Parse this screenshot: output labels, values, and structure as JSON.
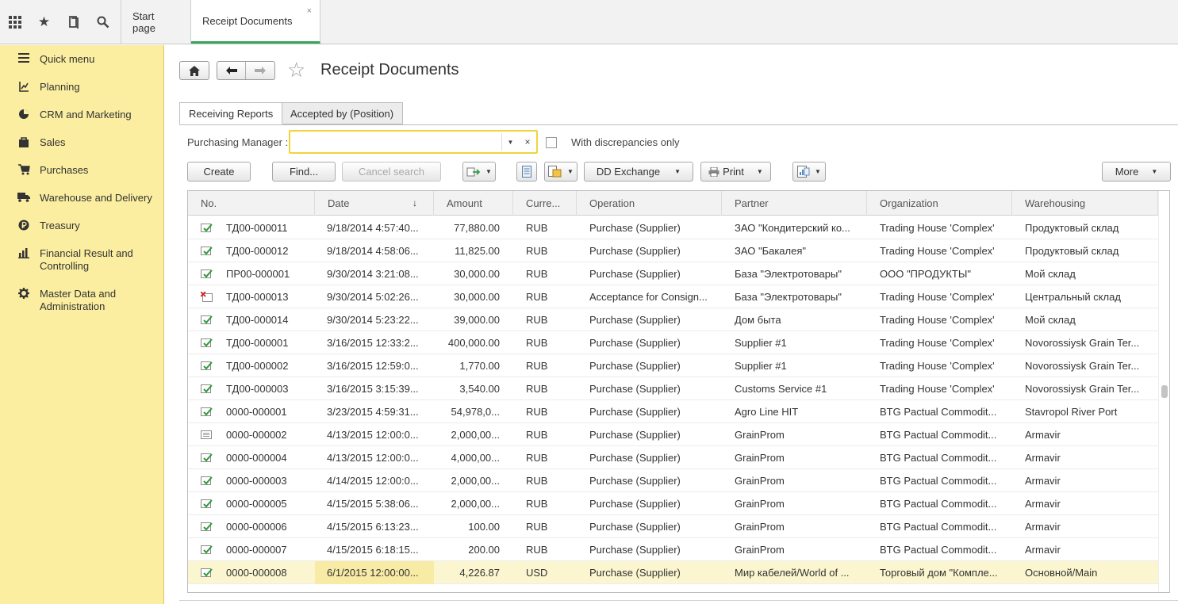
{
  "topbar": {
    "icons": [
      "apps-grid-icon",
      "star-icon",
      "history-icon",
      "search-icon"
    ],
    "tabs": [
      {
        "label": "Start page"
      },
      {
        "label": "Receipt Documents",
        "close": "×"
      }
    ]
  },
  "sidebar": {
    "items": [
      {
        "label": "Quick menu",
        "icon": "menu-lines-icon"
      },
      {
        "label": "Planning",
        "icon": "planning-icon"
      },
      {
        "label": "CRM and Marketing",
        "icon": "pie-chart-icon"
      },
      {
        "label": "Sales",
        "icon": "shopping-bag-icon"
      },
      {
        "label": "Purchases",
        "icon": "cart-icon"
      },
      {
        "label": "Warehouse and Delivery",
        "icon": "truck-icon"
      },
      {
        "label": "Treasury",
        "icon": "ruble-coin-icon"
      },
      {
        "label": "Financial Result and\nControlling",
        "icon": "bar-chart-icon"
      },
      {
        "label": "Master Data and\nAdministration",
        "icon": "gear-icon"
      }
    ]
  },
  "header": {
    "title": "Receipt Documents"
  },
  "form_tabs": [
    {
      "label": "Receiving Reports",
      "active": true
    },
    {
      "label": "Accepted by (Position)",
      "active": false
    }
  ],
  "filter": {
    "purchasing_manager_label": "Purchasing Manager :",
    "purchasing_manager_value": "",
    "discrepancies_label": "With discrepancies only",
    "discrepancies_checked": false
  },
  "toolbar": {
    "create": "Create",
    "find": "Find...",
    "cancel_search": "Cancel search",
    "dd_exchange": "DD Exchange",
    "print": "Print",
    "more": "More"
  },
  "table": {
    "columns": [
      "No.",
      "Date",
      "Amount",
      "Curre...",
      "Operation",
      "Partner",
      "Organization",
      "Warehousing"
    ],
    "sort_column": "Date",
    "rows": [
      {
        "status": "posted",
        "no": "ТД00-000011",
        "date": "9/18/2014 4:57:40...",
        "amount": "77,880.00",
        "currency": "RUB",
        "operation": "Purchase (Supplier)",
        "partner": "ЗАО \"Кондитерский ко...",
        "organization": "Trading House 'Complex'",
        "warehousing": "Продуктовый склад"
      },
      {
        "status": "posted",
        "no": "ТД00-000012",
        "date": "9/18/2014 4:58:06...",
        "amount": "11,825.00",
        "currency": "RUB",
        "operation": "Purchase (Supplier)",
        "partner": "ЗАО \"Бакалея\"",
        "organization": "Trading House 'Complex'",
        "warehousing": "Продуктовый склад"
      },
      {
        "status": "posted",
        "no": "ПР00-000001",
        "date": "9/30/2014 3:21:08...",
        "amount": "30,000.00",
        "currency": "RUB",
        "operation": "Purchase (Supplier)",
        "partner": "База \"Электротовары\"",
        "organization": "ООО \"ПРОДУКТЫ\"",
        "warehousing": "Мой склад"
      },
      {
        "status": "deleted",
        "no": "ТД00-000013",
        "date": "9/30/2014 5:02:26...",
        "amount": "30,000.00",
        "currency": "RUB",
        "operation": "Acceptance for Consign...",
        "partner": "База \"Электротовары\"",
        "organization": "Trading House 'Complex'",
        "warehousing": "Центральный склад"
      },
      {
        "status": "posted",
        "no": "ТД00-000014",
        "date": "9/30/2014 5:23:22...",
        "amount": "39,000.00",
        "currency": "RUB",
        "operation": "Purchase (Supplier)",
        "partner": "Дом быта",
        "organization": "Trading House 'Complex'",
        "warehousing": "Мой склад"
      },
      {
        "status": "posted",
        "no": "ТД00-000001",
        "date": "3/16/2015 12:33:2...",
        "amount": "400,000.00",
        "currency": "RUB",
        "operation": "Purchase (Supplier)",
        "partner": "Supplier #1",
        "organization": "Trading House 'Complex'",
        "warehousing": "Novorossiysk Grain Ter..."
      },
      {
        "status": "posted",
        "no": "ТД00-000002",
        "date": "3/16/2015 12:59:0...",
        "amount": "1,770.00",
        "currency": "RUB",
        "operation": "Purchase (Supplier)",
        "partner": "Supplier #1",
        "organization": "Trading House 'Complex'",
        "warehousing": "Novorossiysk Grain Ter..."
      },
      {
        "status": "posted",
        "no": "ТД00-000003",
        "date": "3/16/2015 3:15:39...",
        "amount": "3,540.00",
        "currency": "RUB",
        "operation": "Purchase (Supplier)",
        "partner": "Customs Service #1",
        "organization": "Trading House 'Complex'",
        "warehousing": "Novorossiysk Grain Ter..."
      },
      {
        "status": "posted",
        "no": "0000-000001",
        "date": "3/23/2015 4:59:31...",
        "amount": "54,978,0...",
        "currency": "RUB",
        "operation": "Purchase (Supplier)",
        "partner": "Agro Line HIT",
        "organization": "BTG Pactual Commodit...",
        "warehousing": "Stavropol River Port"
      },
      {
        "status": "draft",
        "no": "0000-000002",
        "date": "4/13/2015 12:00:0...",
        "amount": "2,000,00...",
        "currency": "RUB",
        "operation": "Purchase (Supplier)",
        "partner": "GrainProm",
        "organization": "BTG Pactual Commodit...",
        "warehousing": "Armavir"
      },
      {
        "status": "posted",
        "no": "0000-000004",
        "date": "4/13/2015 12:00:0...",
        "amount": "4,000,00...",
        "currency": "RUB",
        "operation": "Purchase (Supplier)",
        "partner": "GrainProm",
        "organization": "BTG Pactual Commodit...",
        "warehousing": "Armavir"
      },
      {
        "status": "posted",
        "no": "0000-000003",
        "date": "4/14/2015 12:00:0...",
        "amount": "2,000,00...",
        "currency": "RUB",
        "operation": "Purchase (Supplier)",
        "partner": "GrainProm",
        "organization": "BTG Pactual Commodit...",
        "warehousing": "Armavir"
      },
      {
        "status": "posted",
        "no": "0000-000005",
        "date": "4/15/2015 5:38:06...",
        "amount": "2,000,00...",
        "currency": "RUB",
        "operation": "Purchase (Supplier)",
        "partner": "GrainProm",
        "organization": "BTG Pactual Commodit...",
        "warehousing": "Armavir"
      },
      {
        "status": "posted",
        "no": "0000-000006",
        "date": "4/15/2015 6:13:23...",
        "amount": "100.00",
        "currency": "RUB",
        "operation": "Purchase (Supplier)",
        "partner": "GrainProm",
        "organization": "BTG Pactual Commodit...",
        "warehousing": "Armavir"
      },
      {
        "status": "posted",
        "no": "0000-000007",
        "date": "4/15/2015 6:18:15...",
        "amount": "200.00",
        "currency": "RUB",
        "operation": "Purchase (Supplier)",
        "partner": "GrainProm",
        "organization": "BTG Pactual Commodit...",
        "warehousing": "Armavir"
      },
      {
        "status": "posted",
        "no": "0000-000008",
        "date": "6/1/2015 12:00:00...",
        "amount": "4,226.87",
        "currency": "USD",
        "operation": "Purchase (Supplier)",
        "partner": "Мир кабелей/World of ...",
        "organization": "Торговый дом \"Компле...",
        "warehousing": "Основной/Main",
        "selected": true
      }
    ]
  },
  "colors": {
    "sidebar_bg": "#fbeea0",
    "active_tab_underline": "#3aa55a",
    "focus_border": "#f2d33b",
    "selected_row": "#fbf6cf"
  }
}
